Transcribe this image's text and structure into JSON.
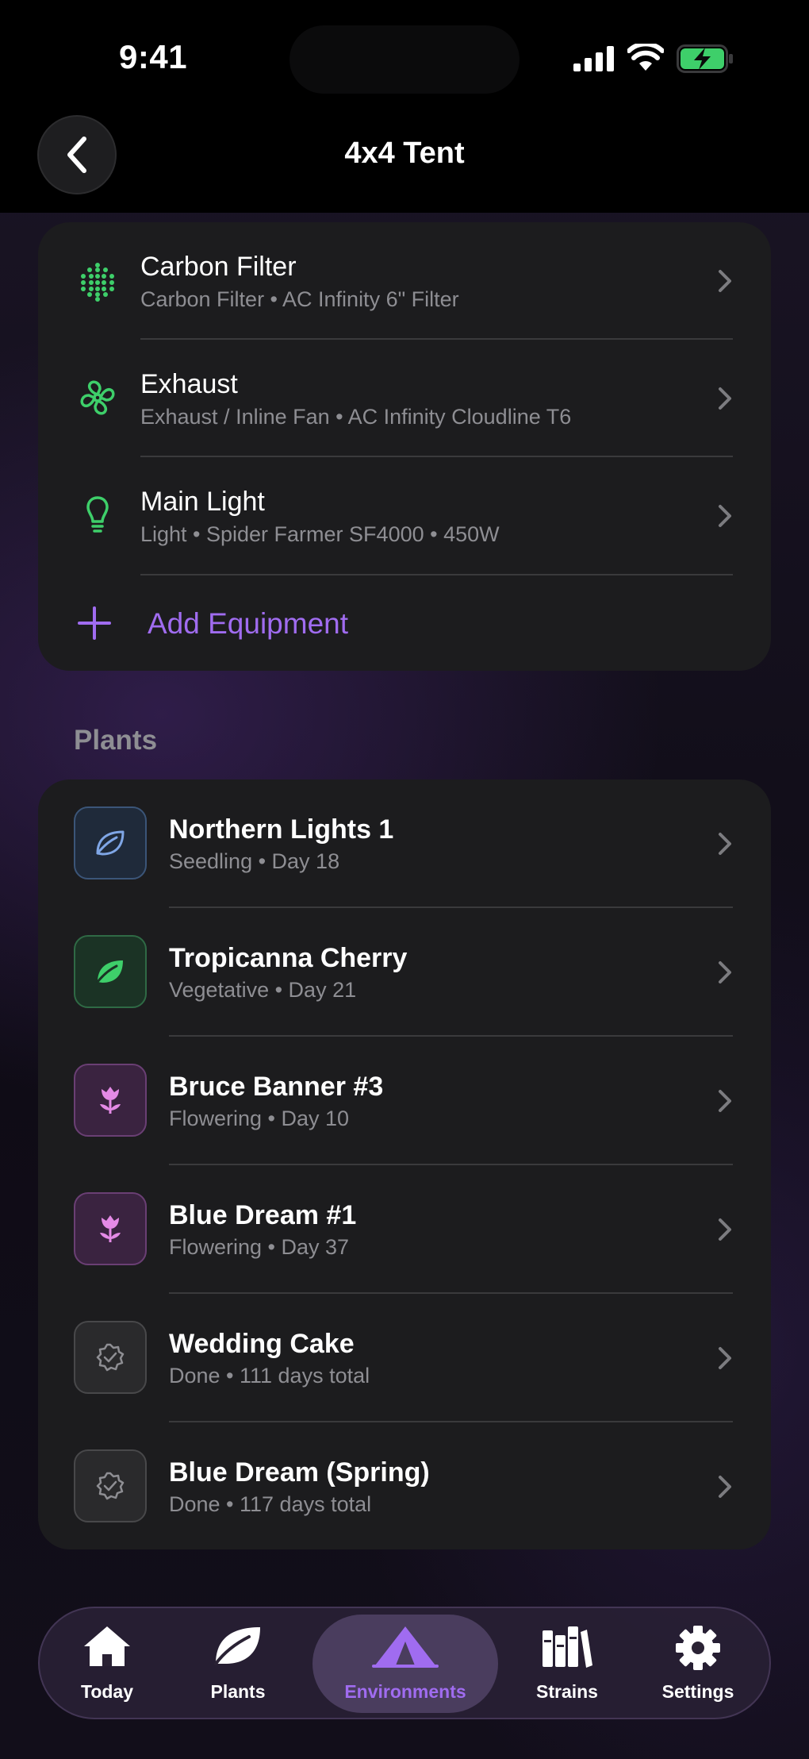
{
  "status_bar": {
    "time": "9:41"
  },
  "header": {
    "title": "4x4 Tent"
  },
  "equipment": {
    "items": [
      {
        "title": "Carbon Filter",
        "subtitle": "Carbon Filter • AC Infinity 6\" Filter",
        "icon": "carbon-filter-icon"
      },
      {
        "title": "Exhaust",
        "subtitle": "Exhaust / Inline Fan • AC Infinity Cloudline T6",
        "icon": "fan-icon"
      },
      {
        "title": "Main Light",
        "subtitle": "Light • Spider Farmer SF4000 • 450W",
        "icon": "lightbulb-icon"
      }
    ],
    "add_label": "Add Equipment"
  },
  "plants": {
    "section_label": "Plants",
    "items": [
      {
        "title": "Northern Lights 1",
        "subtitle": "Seedling • Day 18",
        "stage": "seedling",
        "icon": "leaf-outline-icon"
      },
      {
        "title": "Tropicanna Cherry",
        "subtitle": "Vegetative • Day 21",
        "stage": "vegetative",
        "icon": "leaf-icon"
      },
      {
        "title": "Bruce Banner #3",
        "subtitle": "Flowering • Day 10",
        "stage": "flowering",
        "icon": "flower-icon"
      },
      {
        "title": "Blue Dream #1",
        "subtitle": "Flowering • Day 37",
        "stage": "flowering",
        "icon": "flower-icon"
      },
      {
        "title": "Wedding Cake",
        "subtitle": "Done • 111 days total",
        "stage": "done",
        "icon": "check-seal-icon"
      },
      {
        "title": "Blue Dream (Spring)",
        "subtitle": "Done • 117 days total",
        "stage": "done",
        "icon": "check-seal-icon"
      }
    ]
  },
  "tab_bar": {
    "tabs": [
      {
        "label": "Today",
        "icon": "house-icon"
      },
      {
        "label": "Plants",
        "icon": "leaf-icon"
      },
      {
        "label": "Environments",
        "icon": "tent-icon",
        "active": true
      },
      {
        "label": "Strains",
        "icon": "books-icon"
      },
      {
        "label": "Settings",
        "icon": "gear-icon"
      }
    ]
  },
  "colors": {
    "accent": "#a06cf0",
    "equipment_icon": "#3ecf6a",
    "seedling": "#7fa6e6",
    "vegetative": "#3ecf6a",
    "flowering": "#e48ae6",
    "done": "#8e8e93"
  }
}
